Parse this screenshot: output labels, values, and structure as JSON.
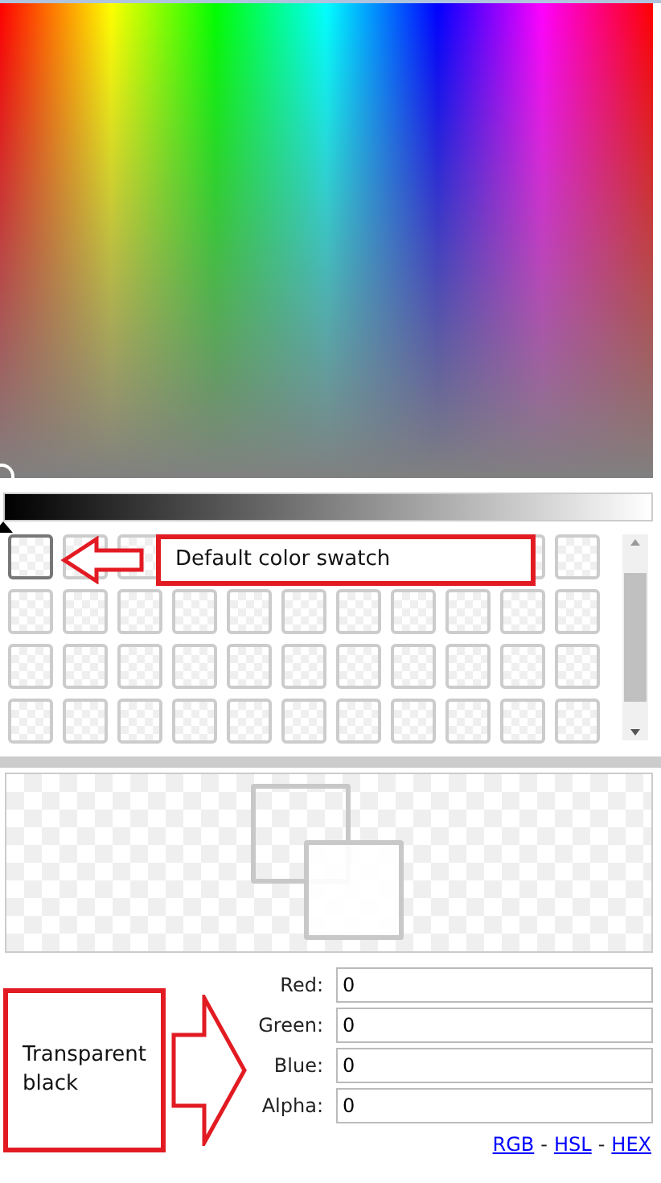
{
  "spectrum": {
    "kind": "hue-saturation"
  },
  "lightness": {
    "level": 0
  },
  "swatches": [
    {
      "selected": true
    },
    {
      "selected": false
    },
    {
      "selected": false
    },
    {
      "selected": false
    },
    {
      "selected": false
    },
    {
      "selected": false
    },
    {
      "selected": false
    },
    {
      "selected": false
    },
    {
      "selected": false
    },
    {
      "selected": false
    },
    {
      "selected": false
    },
    {
      "selected": false
    },
    {
      "selected": false
    },
    {
      "selected": false
    },
    {
      "selected": false
    },
    {
      "selected": false
    },
    {
      "selected": false
    },
    {
      "selected": false
    },
    {
      "selected": false
    },
    {
      "selected": false
    },
    {
      "selected": false
    },
    {
      "selected": false
    },
    {
      "selected": false
    },
    {
      "selected": false
    },
    {
      "selected": false
    },
    {
      "selected": false
    },
    {
      "selected": false
    },
    {
      "selected": false
    },
    {
      "selected": false
    },
    {
      "selected": false
    },
    {
      "selected": false
    },
    {
      "selected": false
    },
    {
      "selected": false
    },
    {
      "selected": false
    },
    {
      "selected": false
    },
    {
      "selected": false
    },
    {
      "selected": false
    },
    {
      "selected": false
    }
  ],
  "swatch_callout": "Default color swatch",
  "value_callout": "Transparent black",
  "fields": [
    {
      "label": "Red:",
      "value": "0"
    },
    {
      "label": "Green:",
      "value": "0"
    },
    {
      "label": "Blue:",
      "value": "0"
    },
    {
      "label": "Alpha:",
      "value": "0"
    }
  ],
  "formats": [
    {
      "label": "RGB"
    },
    {
      "label": "HSL"
    },
    {
      "label": "HEX"
    }
  ],
  "format_separator": "-"
}
